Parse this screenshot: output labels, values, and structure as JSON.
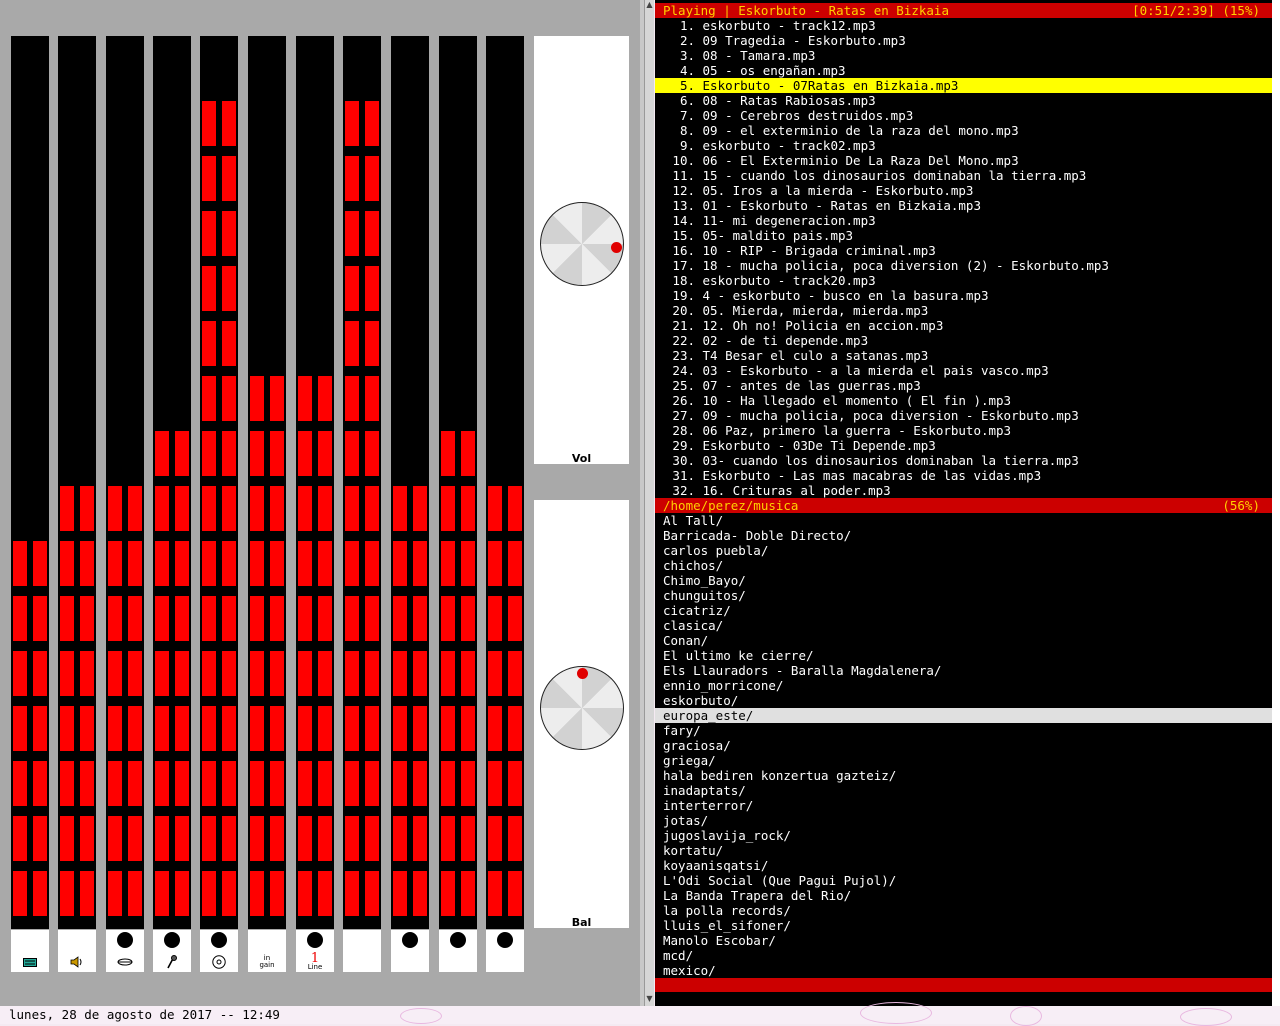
{
  "mixer": {
    "channels": [
      {
        "id": "ch1",
        "icon": "keyboard-icon",
        "has_dot": false,
        "level": 0.41,
        "label": ""
      },
      {
        "id": "ch2",
        "icon": "speaker-icon",
        "has_dot": false,
        "level": 0.53,
        "label": ""
      },
      {
        "id": "ch3",
        "icon": "synth-icon",
        "has_dot": true,
        "level": 0.53,
        "label": ""
      },
      {
        "id": "ch4",
        "icon": "microphone-icon",
        "has_dot": true,
        "level": 0.59,
        "label": ""
      },
      {
        "id": "ch5",
        "icon": "cd-icon",
        "has_dot": true,
        "level": 0.96,
        "label": ""
      },
      {
        "id": "ch6",
        "icon": "in-gain-icon",
        "has_dot": false,
        "level": 0.65,
        "label": "in\ngain"
      },
      {
        "id": "ch7",
        "icon": "line-icon",
        "has_dot": true,
        "level": 0.65,
        "label": "1\nLine"
      },
      {
        "id": "ch8",
        "icon": "",
        "has_dot": false,
        "level": 0.96,
        "label": ""
      },
      {
        "id": "ch9",
        "icon": "",
        "has_dot": true,
        "level": 0.47,
        "label": ""
      },
      {
        "id": "ch10",
        "icon": "",
        "has_dot": true,
        "level": 0.59,
        "label": ""
      },
      {
        "id": "ch11",
        "icon": "",
        "has_dot": true,
        "level": 0.47,
        "label": ""
      }
    ],
    "vol_label": "Vol",
    "bal_label": "Bal",
    "vol_angle_deg": 95,
    "bal_angle_deg": 0
  },
  "colors": {
    "accent_red": "#cc0000",
    "meter_red": "#ff0000",
    "bar_text": "#ffd000",
    "selected_track": "#ffff00",
    "selected_dir": "#e0e0e0"
  },
  "player": {
    "header_left": "Playing | Eskorbuto - Ratas en Bizkaia",
    "header_right": "[0:51/2:39] (15%)",
    "current_index": 5,
    "playlist": [
      "eskorbuto - track12.mp3",
      "09 Tragedia - Eskorbuto.mp3",
      "08 - Tamara.mp3",
      "05 - os engañan.mp3",
      "Eskorbuto - 07Ratas en Bizkaia.mp3",
      "08 - Ratas Rabiosas.mp3",
      "09 - Cerebros destruidos.mp3",
      "09 - el exterminio de la raza del mono.mp3",
      "eskorbuto - track02.mp3",
      "06 - El Exterminio De La Raza Del Mono.mp3",
      "15 - cuando los dinosaurios dominaban la tierra.mp3",
      "05. Iros a la mierda - Eskorbuto.mp3",
      "01 - Eskorbuto - Ratas en Bizkaia.mp3",
      "11- mi degeneracion.mp3",
      "05- maldito pais.mp3",
      "10 - RIP - Brigada criminal.mp3",
      "18 - mucha policia, poca diversion (2) - Eskorbuto.mp3",
      "eskorbuto - track20.mp3",
      "4 - eskorbuto - busco en la basura.mp3",
      "05. Mierda, mierda, mierda.mp3",
      "12. Oh no! Policia en accion.mp3",
      "02 - de ti depende.mp3",
      "T4 Besar el culo a satanas.mp3",
      "03 - Eskorbuto - a la mierda el pais vasco.mp3",
      "07 - antes de las guerras.mp3",
      "10 - Ha llegado el momento ( El fin ).mp3",
      "09 - mucha policia, poca diversion - Eskorbuto.mp3",
      "06 Paz, primero la guerra - Eskorbuto.mp3",
      "Eskorbuto - 03De Ti Depende.mp3",
      "03- cuando los dinosaurios dominaban la tierra.mp3",
      "Eskorbuto - Las mas macabras de las vidas.mp3",
      "16. Crituras al poder.mp3"
    ],
    "browser_header_left": "/home/perez/musica",
    "browser_header_right": "(56%)",
    "browser_selected": "europa_este/",
    "browser_items": [
      "Al Tall/",
      "Barricada- Doble Directo/",
      "carlos puebla/",
      "chichos/",
      "Chimo_Bayo/",
      "chunguitos/",
      "cicatriz/",
      "clasica/",
      "Conan/",
      "El ultimo ke cierre/",
      "Els Llauradors - Baralla Magdalenera/",
      "ennio_morricone/",
      "eskorbuto/",
      "europa_este/",
      "fary/",
      "graciosa/",
      "griega/",
      "hala bediren konzertua gazteiz/",
      "inadaptats/",
      "interterror/",
      "jotas/",
      "jugoslavija_rock/",
      "kortatu/",
      "koyaanisqatsi/",
      "L'Odi Social (Que Pagui Pujol)/",
      "La Banda Trapera del Rio/",
      "la polla records/",
      "lluis_el_sifoner/",
      "Manolo Escobar/",
      "mcd/",
      "mexico/"
    ]
  },
  "statusbar": {
    "clock": "lunes, 28 de agosto de 2017 -- 12:49"
  }
}
